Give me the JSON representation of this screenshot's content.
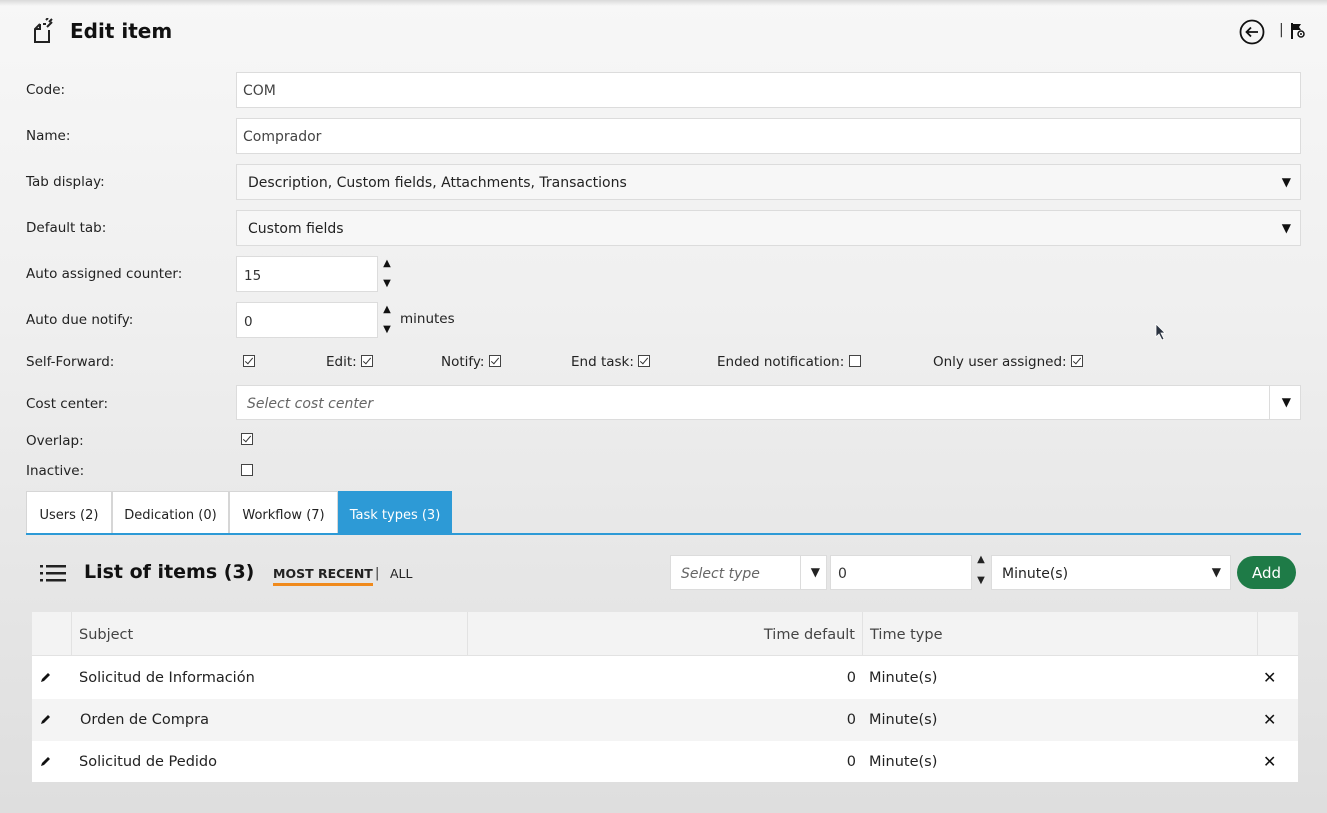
{
  "header": {
    "title": "Edit item"
  },
  "form": {
    "code_label": "Code:",
    "code_value": "COM",
    "name_label": "Name:",
    "name_value": "Comprador",
    "tab_display_label": "Tab display:",
    "tab_display_value": "Description, Custom fields, Attachments, Transactions",
    "default_tab_label": "Default tab:",
    "default_tab_value": "Custom fields",
    "auto_assigned_label": "Auto assigned counter:",
    "auto_assigned_value": "15",
    "auto_due_label": "Auto due notify:",
    "auto_due_value": "0",
    "auto_due_unit": "minutes",
    "self_forward_label": "Self-Forward:",
    "self_forward_checked": true,
    "edit_label": "Edit:",
    "edit_checked": true,
    "notify_label": "Notify:",
    "notify_checked": true,
    "end_task_label": "End task:",
    "end_task_checked": true,
    "ended_notification_label": "Ended notification:",
    "ended_notification_checked": false,
    "only_user_label": "Only user assigned:",
    "only_user_checked": true,
    "cost_center_label": "Cost center:",
    "cost_center_placeholder": "Select cost center",
    "overlap_label": "Overlap:",
    "overlap_checked": true,
    "inactive_label": "Inactive:",
    "inactive_checked": false
  },
  "tabs": [
    {
      "label": "Users (2)",
      "active": false
    },
    {
      "label": "Dedication (0)",
      "active": false
    },
    {
      "label": "Workflow (7)",
      "active": false
    },
    {
      "label": "Task types (3)",
      "active": true
    }
  ],
  "list": {
    "title": "List of items (3)",
    "filter_most_recent": "MOST RECENT",
    "filter_separator": "|",
    "filter_all": "ALL",
    "select_type_placeholder": "Select type",
    "quantity_value": "0",
    "unit_value": "Minute(s)",
    "add_label": "Add",
    "columns": [
      "Subject",
      "Time default",
      "Time type"
    ],
    "rows": [
      {
        "subject": "Solicitud de Información",
        "time_default": "0",
        "time_type": "Minute(s)"
      },
      {
        "subject": "Orden de Compra",
        "time_default": "0",
        "time_type": "Minute(s)"
      },
      {
        "subject": "Solicitud de Pedido",
        "time_default": "0",
        "time_type": "Minute(s)"
      }
    ]
  },
  "colors": {
    "accent": "#2d9ad6",
    "add_button": "#1e7b47",
    "active_filter_underline": "#f08a1c"
  },
  "icons": {
    "header": [
      "edit-document-icon",
      "back-arrow-icon",
      "flag-settings-icon"
    ],
    "list": "list-icon",
    "row_edit": "pencil-icon",
    "row_delete": "close-icon",
    "dropdown": "caret-down-icon"
  }
}
